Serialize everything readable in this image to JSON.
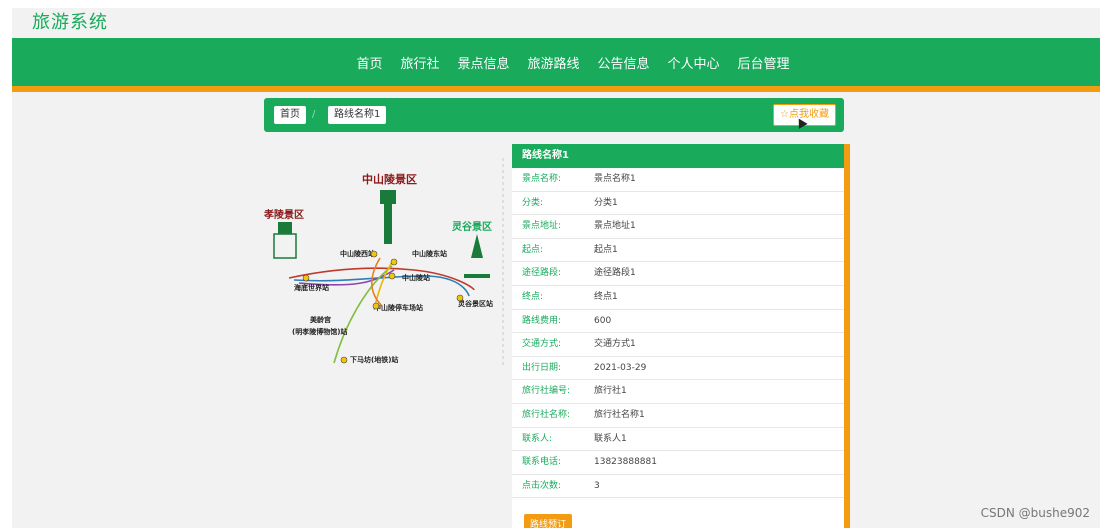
{
  "brand": {
    "title": "旅游系统"
  },
  "nav": [
    "首页",
    "旅行社",
    "景点信息",
    "旅游路线",
    "公告信息",
    "个人中心",
    "后台管理"
  ],
  "breadcrumb": {
    "home": "首页",
    "separator": "/",
    "current": "路线名称1"
  },
  "favorite": {
    "label": "☆点我收藏"
  },
  "map": {
    "area1": "中山陵景区",
    "area2": "孝陵景区",
    "area3": "灵谷景区",
    "stations": [
      "中山陵西站",
      "中山陵东站",
      "中山陵站",
      "海底世界站",
      "中山陵停车场站",
      "灵谷景区站",
      "美龄宫",
      "(明孝陵博物馆)站",
      "下马坊(地铁)站"
    ]
  },
  "detail": {
    "title": "路线名称1",
    "rows": [
      {
        "k": "景点名称:",
        "v": "景点名称1"
      },
      {
        "k": "分类:",
        "v": "分类1"
      },
      {
        "k": "景点地址:",
        "v": "景点地址1"
      },
      {
        "k": "起点:",
        "v": "起点1"
      },
      {
        "k": "途径路段:",
        "v": "途径路段1"
      },
      {
        "k": "终点:",
        "v": "终点1"
      },
      {
        "k": "路线费用:",
        "v": "600"
      },
      {
        "k": "交通方式:",
        "v": "交通方式1"
      },
      {
        "k": "出行日期:",
        "v": "2021-03-29"
      },
      {
        "k": "旅行社编号:",
        "v": "旅行社1"
      },
      {
        "k": "旅行社名称:",
        "v": "旅行社名称1"
      },
      {
        "k": "联系人:",
        "v": "联系人1"
      },
      {
        "k": "联系电话:",
        "v": "13823888881"
      },
      {
        "k": "点击次数:",
        "v": "3"
      }
    ],
    "book_label": "路线预订"
  },
  "watermark": "CSDN @bushe902",
  "colors": {
    "primary": "#1aaa5c",
    "accent": "#f39c12"
  }
}
